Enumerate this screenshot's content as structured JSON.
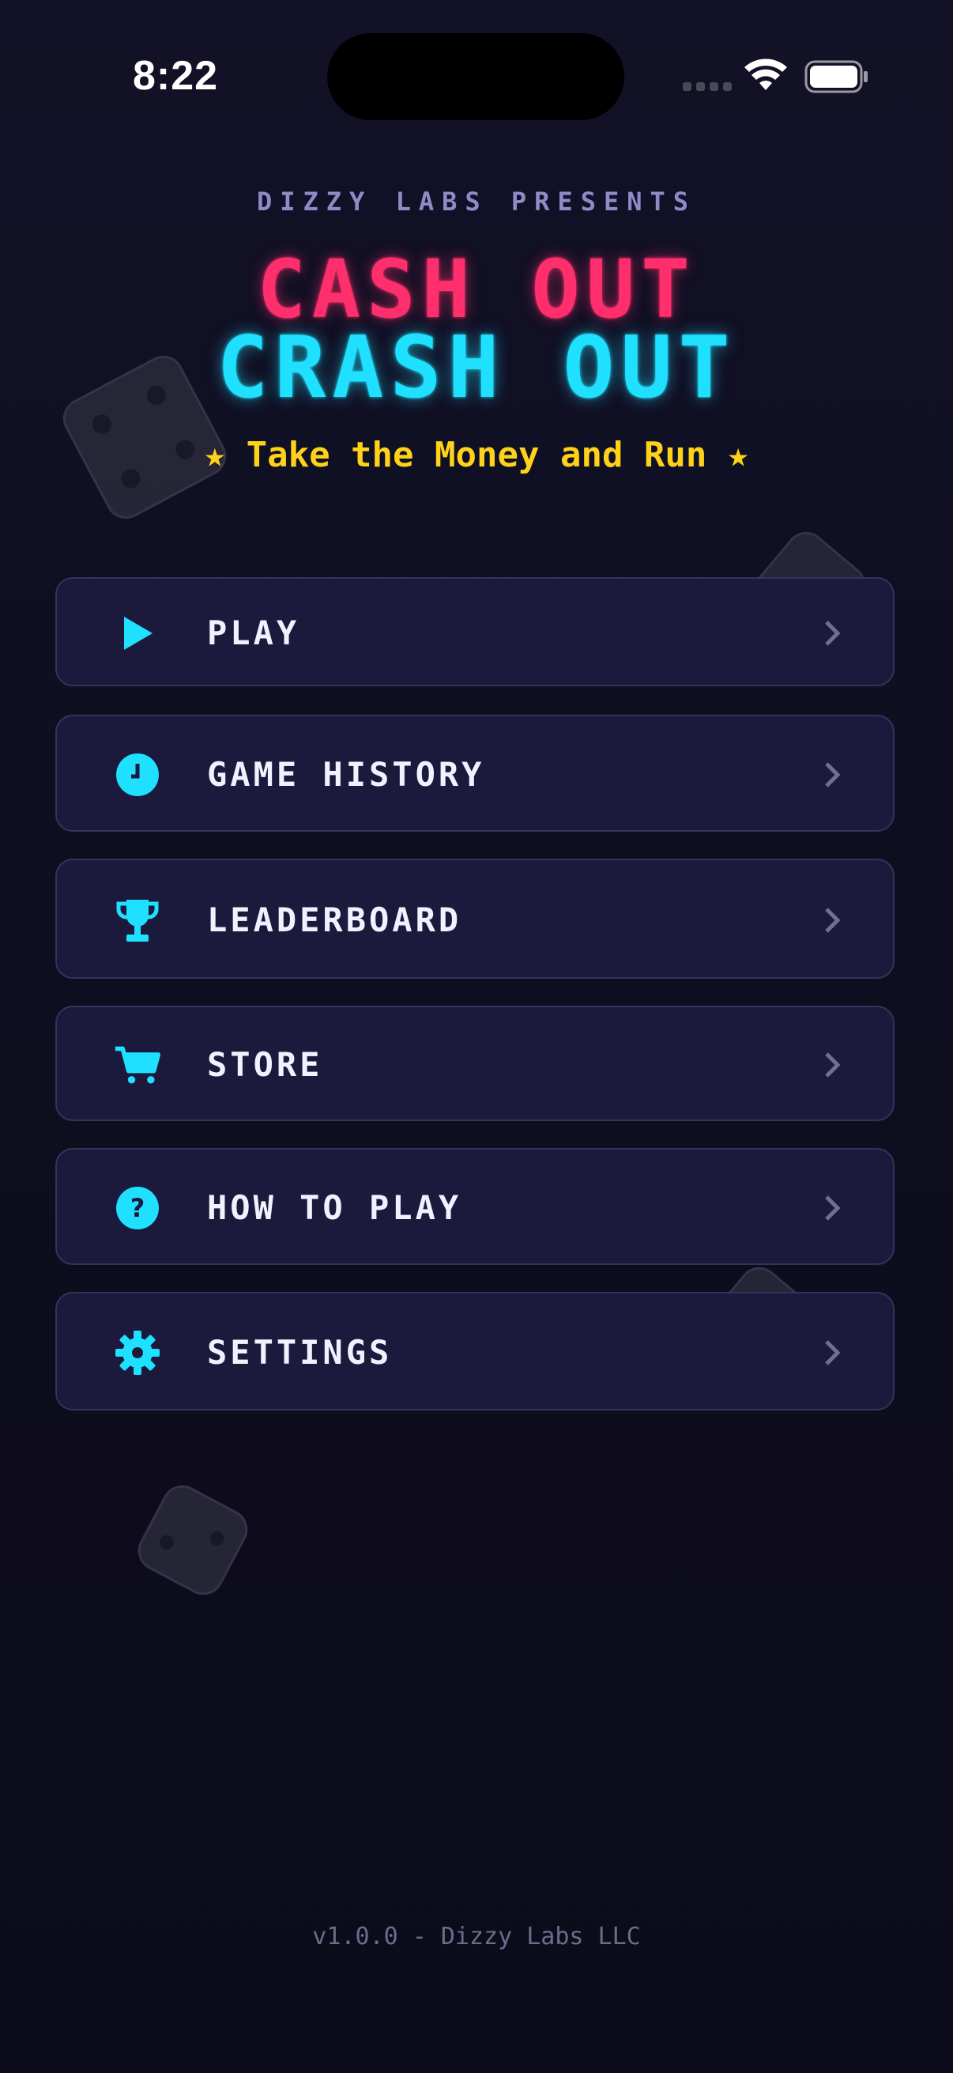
{
  "status_bar": {
    "time": "8:22"
  },
  "header": {
    "presents": "DIZZY LABS PRESENTS",
    "title_line_1": "CASH OUT",
    "title_line_2": "CRASH OUT",
    "tagline": "★ Take the Money and Run ★"
  },
  "menu": {
    "items": [
      {
        "label": "PLAY",
        "icon": "play-icon"
      },
      {
        "label": "GAME HISTORY",
        "icon": "clock-icon"
      },
      {
        "label": "LEADERBOARD",
        "icon": "trophy-icon"
      },
      {
        "label": "STORE",
        "icon": "cart-icon"
      },
      {
        "label": "HOW TO PLAY",
        "icon": "question-icon"
      },
      {
        "label": "SETTINGS",
        "icon": "gear-icon"
      }
    ]
  },
  "footer": {
    "version": "v1.0.0 - Dizzy Labs LLC"
  },
  "colors": {
    "accent_cyan": "#1fe0ff",
    "accent_pink": "#ff2e6c",
    "accent_yellow": "#ffd21a",
    "card_bg": "#1b1a3c"
  }
}
